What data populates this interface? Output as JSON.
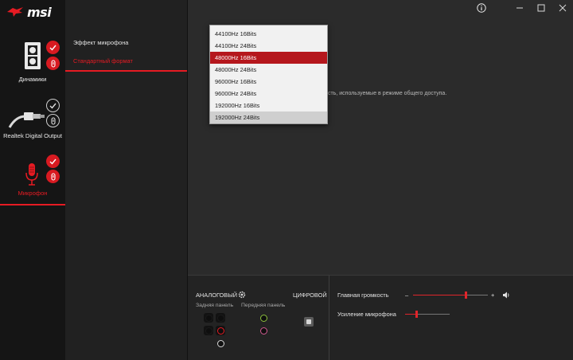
{
  "app": {
    "brand": "msi"
  },
  "window": {
    "info_icon": "info-icon",
    "minimize_icon": "minimize-icon",
    "maximize_icon": "maximize-icon",
    "close_icon": "close-icon"
  },
  "devices": [
    {
      "label": "Динамики",
      "icon": "speaker-icon",
      "active": false,
      "checked": true
    },
    {
      "label": "Realtek Digital Output",
      "icon": "digital-cable-icon",
      "active": false,
      "checked": false
    },
    {
      "label": "Микрофон",
      "icon": "microphone-icon",
      "active": true,
      "checked": true
    }
  ],
  "subtabs": [
    {
      "label": "Эффект микрофона",
      "active": false
    },
    {
      "label": "Стандартный формат",
      "active": true
    }
  ],
  "description": "сть, используемые в режиме общего доступа.",
  "format_dropdown": {
    "options": [
      "44100Hz 16Bits",
      "44100Hz 24Bits",
      "48000Hz 16Bits",
      "48000Hz 24Bits",
      "96000Hz 16Bits",
      "96000Hz 24Bits",
      "192000Hz 16Bits",
      "192000Hz 24Bits"
    ],
    "selected": "48000Hz 16Bits",
    "hovered": "192000Hz 24Bits"
  },
  "connectors": {
    "analog_label": "АНАЛОГОВЫЙ",
    "digital_label": "ЦИФРОВОЙ",
    "rear_panel_label": "Задняя панель",
    "front_panel_label": "Передняя панель",
    "colors": {
      "accent": "#e61b23",
      "front_green": "#8bbf3c",
      "front_pink": "#d35b92"
    }
  },
  "volume": {
    "main_label": "Главная громкость",
    "minus": "–",
    "plus": "+",
    "main_level": 0.71,
    "boost_label": "Усиление микрофона",
    "boost_level": 0.25
  }
}
